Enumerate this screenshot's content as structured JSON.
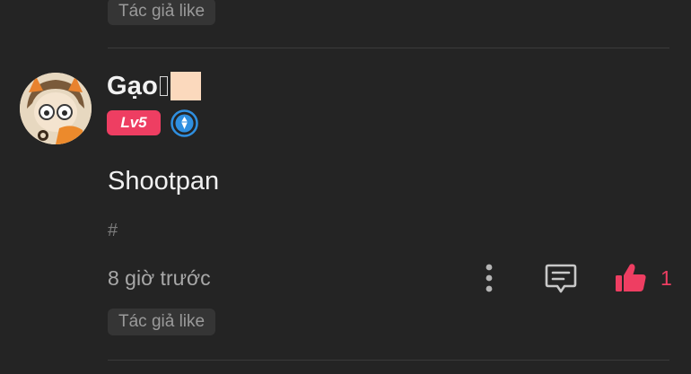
{
  "previous_comment": {
    "author_like_label": "Tác giả like"
  },
  "comment": {
    "username": "Gạo",
    "level": "Lv5",
    "text": "Shootpan",
    "hashtag": "#",
    "timestamp": "8 giờ trước",
    "like_count": "1",
    "author_like_label": "Tác giả like",
    "icons": [
      "avatar",
      "verified-badge-icon",
      "more-icon",
      "reply-icon",
      "thumbs-up-icon"
    ]
  },
  "colors": {
    "background": "#242424",
    "accent": "#ee3e62",
    "verified": "#2f8fe0",
    "pill_bg": "#353535"
  }
}
